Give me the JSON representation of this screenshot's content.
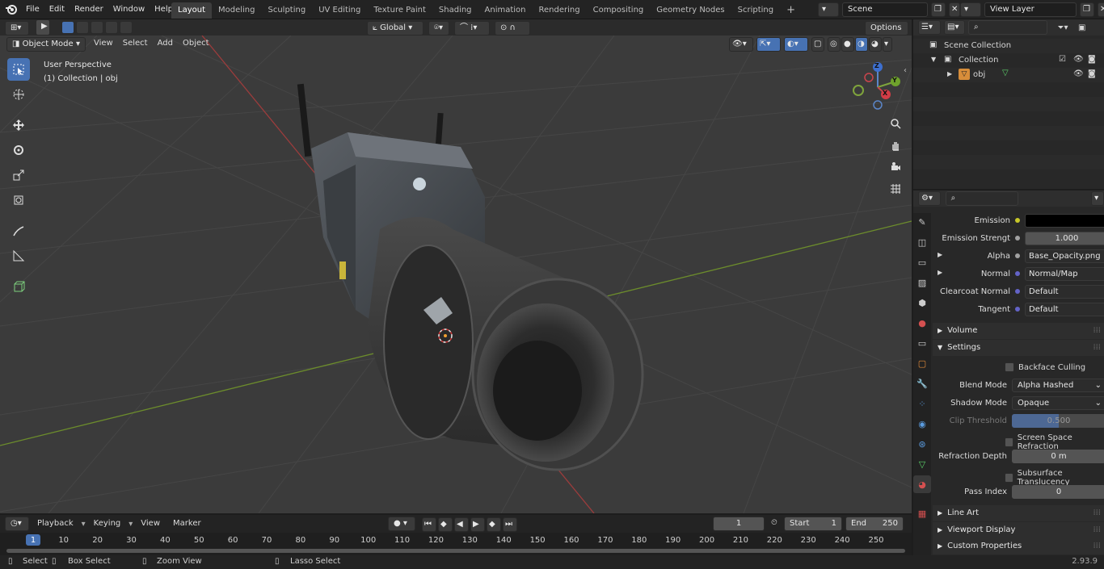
{
  "topbar": {
    "menus": [
      "File",
      "Edit",
      "Render",
      "Window",
      "Help"
    ],
    "workspaces": [
      "Layout",
      "Modeling",
      "Sculpting",
      "UV Editing",
      "Texture Paint",
      "Shading",
      "Animation",
      "Rendering",
      "Compositing",
      "Geometry Nodes",
      "Scripting"
    ],
    "active_workspace": "Layout",
    "add_tab": "+",
    "scene": "Scene",
    "view_layer": "View Layer"
  },
  "viewport_header": {
    "mode": "Object Mode",
    "menus": [
      "View",
      "Select",
      "Add",
      "Object"
    ],
    "transform": "Global",
    "options": "Options"
  },
  "viewport": {
    "perspective": "User Perspective",
    "collection": "(1) Collection | obj",
    "gizmo": {
      "z": "Z",
      "y": "Y",
      "x": "X"
    }
  },
  "outliner": {
    "root": "Scene Collection",
    "collection": "Collection",
    "object": "obj"
  },
  "properties": {
    "rows": [
      {
        "label": "Emission",
        "value": "",
        "socket": "#c7c729"
      },
      {
        "label": "Emission Strengt",
        "value": "1.000",
        "socket": "#a1a1a1"
      },
      {
        "label": "Alpha",
        "value": "Base_Opacity.png",
        "socket": "#a1a1a1"
      },
      {
        "label": "Normal",
        "value": "Normal/Map",
        "socket": "#6363c7"
      },
      {
        "label": "Clearcoat Normal",
        "value": "Default",
        "socket": "#6363c7"
      },
      {
        "label": "Tangent",
        "value": "Default",
        "socket": "#6363c7"
      }
    ],
    "panels": {
      "volume": "Volume",
      "settings": "Settings",
      "line_art": "Line Art",
      "viewport_display": "Viewport Display",
      "custom_properties": "Custom Properties"
    },
    "settings": {
      "backface_culling": "Backface Culling",
      "blend_mode_label": "Blend Mode",
      "blend_mode": "Alpha Hashed",
      "shadow_mode_label": "Shadow Mode",
      "shadow_mode": "Opaque",
      "clip_threshold_label": "Clip Threshold",
      "clip_threshold": "0.500",
      "ssr": "Screen Space Refraction",
      "refraction_depth_label": "Refraction Depth",
      "refraction_depth": "0 m",
      "sss": "Subsurface Translucency",
      "pass_index_label": "Pass Index",
      "pass_index": "0"
    }
  },
  "timeline": {
    "menus": [
      "Playback",
      "Keying",
      "View",
      "Marker"
    ],
    "current_frame": "1",
    "start_label": "Start",
    "start": "1",
    "end_label": "End",
    "end": "250",
    "ticks": [
      "1",
      "10",
      "20",
      "30",
      "40",
      "50",
      "60",
      "70",
      "80",
      "90",
      "100",
      "110",
      "120",
      "130",
      "140",
      "150",
      "160",
      "170",
      "180",
      "190",
      "200",
      "210",
      "220",
      "230",
      "240",
      "250"
    ]
  },
  "status": {
    "select": "Select",
    "box_select": "Box Select",
    "zoom_view": "Zoom View",
    "lasso_select": "Lasso Select",
    "version": "2.93.9"
  }
}
